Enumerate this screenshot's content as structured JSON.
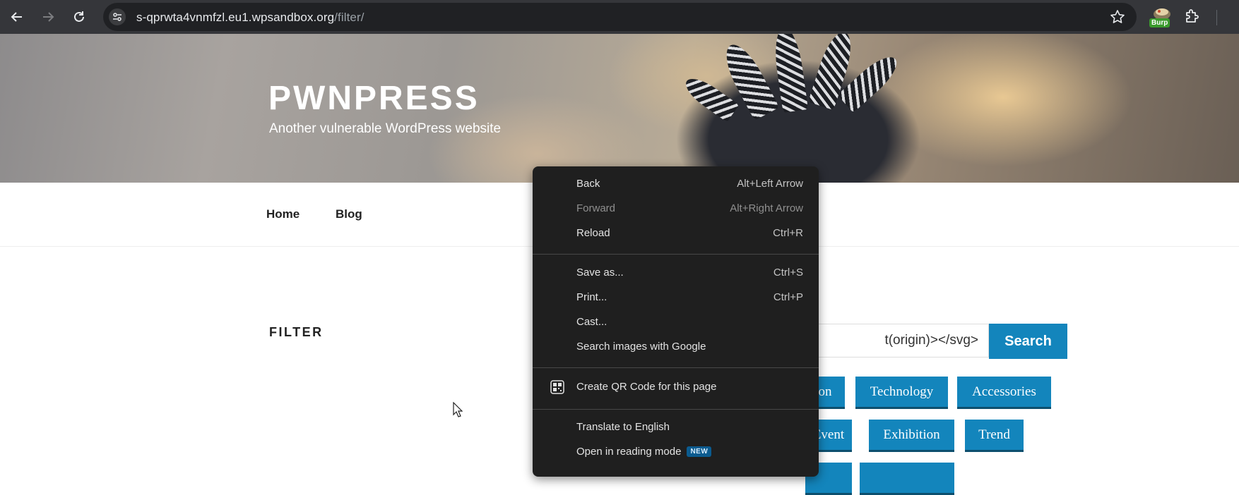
{
  "browser": {
    "url_host": "s-qprwta4vnmfzl.eu1.wpsandbox.org",
    "url_path": "/filter/",
    "extension_badge": "Burp"
  },
  "site": {
    "title": "PWNPRESS",
    "tagline": "Another vulnerable WordPress website",
    "nav": [
      "Home",
      "Blog"
    ]
  },
  "content": {
    "heading": "FILTER",
    "search_value": "t(origin)></svg>",
    "search_button": "Search",
    "tags_row1": [
      "on",
      "Technology",
      "Accessories"
    ],
    "tags_row2": [
      "Event",
      "Exhibition",
      "Trend"
    ]
  },
  "context_menu": {
    "items": [
      {
        "label": "Back",
        "shortcut": "Alt+Left Arrow"
      },
      {
        "label": "Forward",
        "shortcut": "Alt+Right Arrow",
        "disabled": true
      },
      {
        "label": "Reload",
        "shortcut": "Ctrl+R"
      },
      {
        "label": "Save as...",
        "shortcut": "Ctrl+S"
      },
      {
        "label": "Print...",
        "shortcut": "Ctrl+P"
      },
      {
        "label": "Cast..."
      },
      {
        "label": "Search images with Google"
      },
      {
        "label": "Create QR Code for this page",
        "icon": "qr-code-icon"
      },
      {
        "label": "Translate to English"
      },
      {
        "label": "Open in reading mode",
        "badge": "NEW"
      }
    ]
  },
  "colors": {
    "chrome_toolbar": "#35363a",
    "omnibox": "#202124",
    "accent": "#1385bc",
    "menu_bg": "#1f1f1f"
  }
}
